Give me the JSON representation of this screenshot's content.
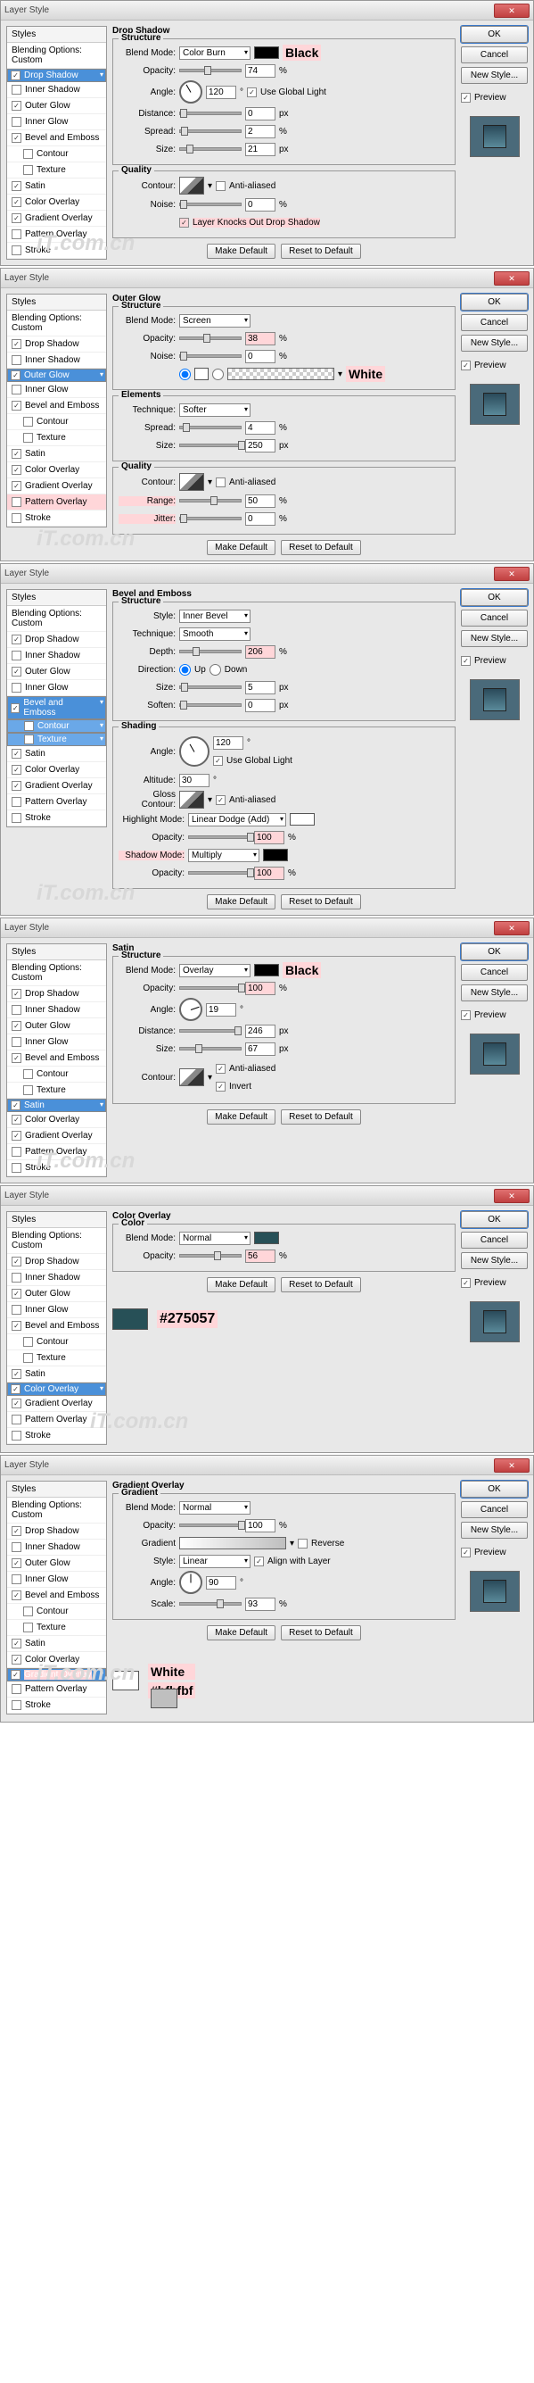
{
  "common": {
    "title": "Layer Style",
    "styles_hdr": "Styles",
    "blend_opts": "Blending Options: Custom",
    "ok": "OK",
    "cancel": "Cancel",
    "newstyle": "New Style...",
    "preview": "Preview",
    "make_default": "Make Default",
    "reset_default": "Reset to Default",
    "watermark": "iT.com.cn"
  },
  "styles": {
    "drop": "Drop Shadow",
    "inner_s": "Inner Shadow",
    "outer_g": "Outer Glow",
    "inner_g": "Inner Glow",
    "bevel": "Bevel and Emboss",
    "contour": "Contour",
    "texture": "Texture",
    "satin": "Satin",
    "color_ov": "Color Overlay",
    "grad_ov": "Gradient Overlay",
    "pat_ov": "Pattern Overlay",
    "stroke": "Stroke"
  },
  "labels": {
    "structure": "Structure",
    "quality": "Quality",
    "elements": "Elements",
    "shading": "Shading",
    "color": "Color",
    "gradient": "Gradient",
    "blend_mode": "Blend Mode:",
    "opacity": "Opacity:",
    "angle": "Angle:",
    "distance": "Distance:",
    "spread": "Spread:",
    "size": "Size:",
    "noise": "Noise:",
    "contour": "Contour:",
    "anti": "Anti-aliased",
    "knockout": "Layer Knocks Out Drop Shadow",
    "use_global": "Use Global Light",
    "technique": "Technique:",
    "range": "Range:",
    "jitter": "Jitter:",
    "style": "Style:",
    "depth": "Depth:",
    "direction": "Direction:",
    "up": "Up",
    "down": "Down",
    "soften": "Soften:",
    "altitude": "Altitude:",
    "gloss": "Gloss Contour:",
    "highlight": "Highlight Mode:",
    "shadow_mode": "Shadow Mode:",
    "invert": "Invert",
    "scale": "Scale:",
    "reverse": "Reverse",
    "align": "Align with Layer",
    "px": "px",
    "pct": "%",
    "deg": "°"
  },
  "p1": {
    "title": "Drop Shadow",
    "mode": "Color Burn",
    "opacity": "74",
    "angle": "120",
    "distance": "0",
    "spread": "2",
    "size": "21",
    "noise": "0",
    "call": "Black"
  },
  "p2": {
    "title": "Outer Glow",
    "mode": "Screen",
    "opacity": "38",
    "noise": "0",
    "tech": "Softer",
    "spread": "4",
    "size": "250",
    "range": "50",
    "jitter": "0",
    "call": "White"
  },
  "p3": {
    "title": "Bevel and Emboss",
    "style": "Inner Bevel",
    "tech": "Smooth",
    "depth": "206",
    "size": "5",
    "soften": "0",
    "angle": "120",
    "altitude": "30",
    "hmode": "Linear Dodge (Add)",
    "hop": "100",
    "smode": "Multiply",
    "sop": "100"
  },
  "p4": {
    "title": "Satin",
    "mode": "Overlay",
    "opacity": "100",
    "angle": "19",
    "distance": "246",
    "size": "67",
    "call": "Black"
  },
  "p5": {
    "title": "Color Overlay",
    "mode": "Normal",
    "opacity": "56",
    "call": "#275057"
  },
  "p6": {
    "title": "Gradient Overlay",
    "mode": "Normal",
    "opacity": "100",
    "style": "Linear",
    "angle": "90",
    "scale": "93",
    "call1": "White",
    "call2": "#bfbfbf"
  }
}
